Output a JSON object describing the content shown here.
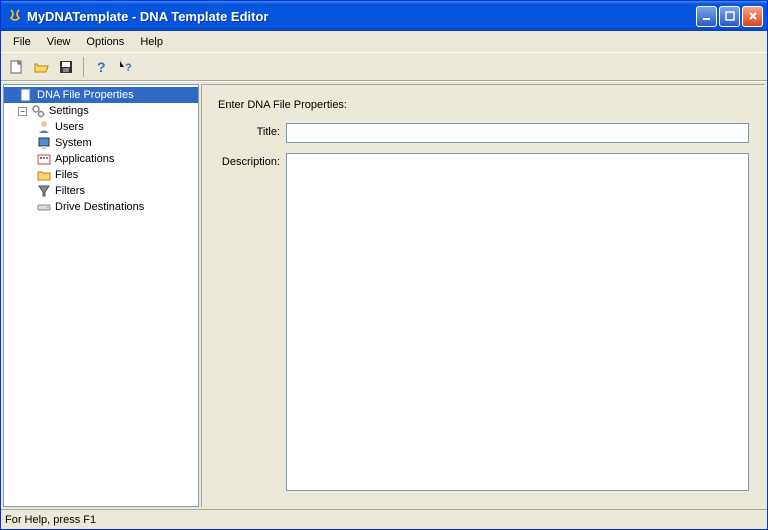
{
  "window": {
    "title": "MyDNATemplate - DNA Template Editor"
  },
  "menu": {
    "file": "File",
    "view": "View",
    "options": "Options",
    "help": "Help"
  },
  "tree": {
    "root": "DNA File Properties",
    "settings": "Settings",
    "users": "Users",
    "system": "System",
    "applications": "Applications",
    "files": "Files",
    "filters": "Filters",
    "drives": "Drive Destinations"
  },
  "form": {
    "heading": "Enter DNA File Properties:",
    "title_label": "Title:",
    "title_value": "",
    "desc_label": "Description:",
    "desc_value": ""
  },
  "status": {
    "text": "For Help, press F1"
  }
}
